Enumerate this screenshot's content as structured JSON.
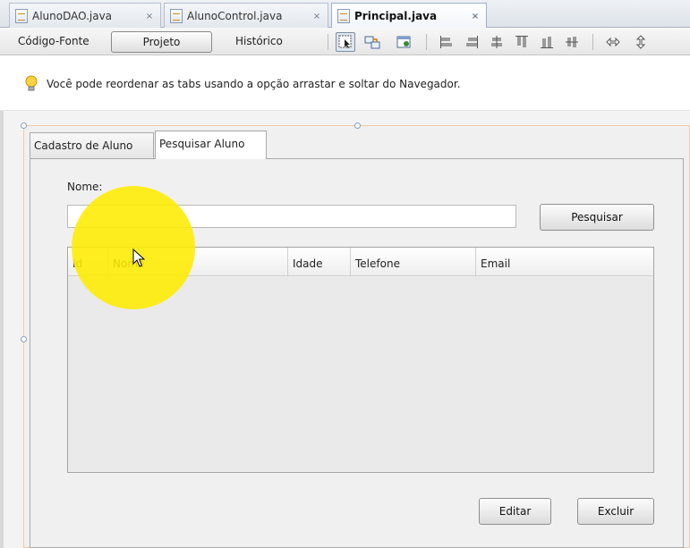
{
  "editor_tabs": [
    {
      "label": "AlunoDAO.java",
      "close": "×",
      "active": false
    },
    {
      "label": "AlunoControl.java",
      "close": "×",
      "active": false
    },
    {
      "label": "Principal.java",
      "close": "×",
      "active": true
    }
  ],
  "view_toolbar": {
    "source_label": "Código-Fonte",
    "design_label": "Projeto",
    "history_label": "Histórico",
    "icons": [
      "selection-mode-icon",
      "connection-mode-icon",
      "preview-design-icon",
      "align-left-icon",
      "align-right-icon",
      "center-horizontal-icon",
      "align-top-icon",
      "align-bottom-icon",
      "center-vertical-icon",
      "resize-width-icon",
      "resize-height-icon"
    ]
  },
  "hint": {
    "icon": "lightbulb-icon",
    "text": "Você pode reordenar as tabs usando a opção arrastar e soltar do Navegador."
  },
  "form": {
    "tabs": [
      {
        "label": "Cadastro de Aluno",
        "active": false
      },
      {
        "label": "Pesquisar Aluno",
        "active": true
      }
    ],
    "name_label": "Nome:",
    "name_value": "",
    "search_button": "Pesquisar",
    "table": {
      "columns": [
        "Id",
        "Nome",
        "Idade",
        "Telefone",
        "Email"
      ],
      "rows": []
    },
    "edit_button": "Editar",
    "delete_button": "Excluir"
  },
  "colors": {
    "cursor_highlight": "#ffec00",
    "form_border": "#f1c9a6"
  }
}
